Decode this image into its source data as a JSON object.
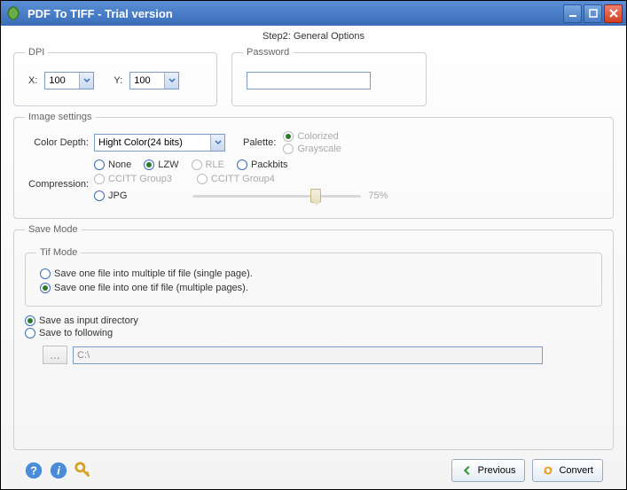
{
  "window": {
    "title": "PDF To TIFF - Trial version"
  },
  "step_label": "Step2: General Options",
  "dpi": {
    "legend": "DPI",
    "x_label": "X:",
    "x_value": "100",
    "y_label": "Y:",
    "y_value": "100"
  },
  "password": {
    "legend": "Password",
    "value": ""
  },
  "image_settings": {
    "legend": "Image settings",
    "color_depth_label": "Color Depth:",
    "color_depth_value": "Hight Color(24 bits)",
    "palette_label": "Palette:",
    "palette_colorized": "Colorized",
    "palette_grayscale": "Grayscale",
    "compression_label": "Compression:",
    "opts": {
      "none": "None",
      "lzw": "LZW",
      "rle": "RLE",
      "packbits": "Packbits",
      "ccitt3": "CCITT Group3",
      "ccitt4": "CCITT Group4",
      "jpg": "JPG"
    },
    "jpg_quality": "75%"
  },
  "save_mode": {
    "legend": "Save Mode",
    "tif_legend": "Tif Mode",
    "tif_single": "Save one file into multiple tif file (single page).",
    "tif_multi": "Save one file into one tif file (multiple pages).",
    "as_input": "Save as input directory",
    "to_following": "Save to following",
    "browse_label": "...",
    "path": "C:\\"
  },
  "footer": {
    "previous": "Previous",
    "convert": "Convert"
  }
}
